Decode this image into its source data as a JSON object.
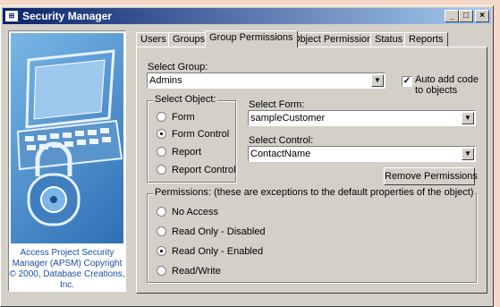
{
  "window": {
    "title": "Security Manager",
    "icon": "access-form-icon",
    "minimize": "_",
    "maximize": "□",
    "close": "×"
  },
  "sidebar": {
    "credit": "Access Project Security Manager (APSM) Copyright © 2000, Database Creations, Inc."
  },
  "tabs": [
    "Users",
    "Groups",
    "Group Permissions",
    "Object Permissions",
    "Status",
    "Reports"
  ],
  "active_tab": "Group Permissions",
  "form": {
    "select_group_label": "Select Group:",
    "select_group_value": "Admins",
    "auto_add_label": "Auto add code to objects",
    "auto_add_checked": true,
    "select_object_label": "Select Object:",
    "object_options": [
      "Form",
      "Form Control",
      "Report",
      "Report Control"
    ],
    "object_selected": "Form Control",
    "select_form_label": "Select Form:",
    "select_form_value": "sampleCustomer",
    "select_control_label": "Select Control:",
    "select_control_value": "ContactName",
    "remove_button": "Remove Permissions",
    "permissions_label": "Permissions: (these are exceptions to the default properties of the object)",
    "permission_options": [
      "No Access",
      "Read Only - Disabled",
      "Read Only - Enabled",
      "Read/Write"
    ],
    "permission_selected": "Read Only - Enabled"
  }
}
